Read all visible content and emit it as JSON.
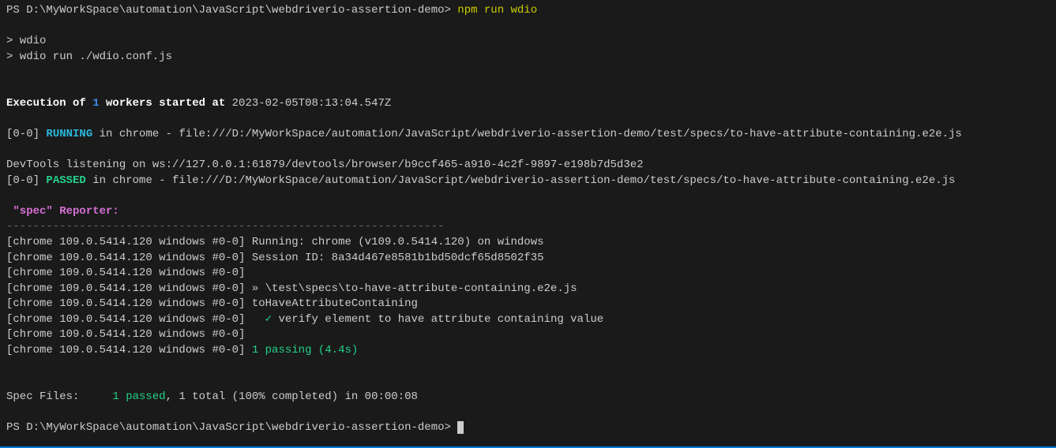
{
  "prompt1_path": "PS D:\\MyWorkSpace\\automation\\JavaScript\\webdriverio-assertion-demo> ",
  "prompt1_cmd": "npm run wdio",
  "script_lines": [
    "> wdio",
    "> wdio run ./wdio.conf.js"
  ],
  "exec_prefix": "Execution of ",
  "exec_workers": "1",
  "exec_mid": " workers started at ",
  "exec_ts": "2023-02-05T08:13:04.547Z",
  "running_prefix": "[0-0] ",
  "running_status": "RUNNING",
  "running_rest": " in chrome - file:///D:/MyWorkSpace/automation/JavaScript/webdriverio-assertion-demo/test/specs/to-have-attribute-containing.e2e.js",
  "devtools": "DevTools listening on ws://127.0.0.1:61879/devtools/browser/b9ccf465-a910-4c2f-9897-e198b7d5d3e2",
  "passed_prefix": "[0-0] ",
  "passed_status": "PASSED",
  "passed_rest": " in chrome - file:///D:/MyWorkSpace/automation/JavaScript/webdriverio-assertion-demo/test/specs/to-have-attribute-containing.e2e.js",
  "reporter_header": " \"spec\" Reporter:",
  "dashes": "------------------------------------------------------------------",
  "spec_prefix": "[chrome 109.0.5414.120 windows #0-0]",
  "spec_line1": " Running: chrome (v109.0.5414.120) on windows",
  "spec_line2": " Session ID: 8a34d467e8581b1bd50dcf65d8502f35",
  "spec_line3": "",
  "spec_line4": " » \\test\\specs\\to-have-attribute-containing.e2e.js",
  "spec_line5": " toHaveAttributeContaining",
  "spec_check": "   ✓ ",
  "spec_checktext": "verify element to have attribute containing value",
  "spec_line7": "",
  "spec_passing": " 1 passing (4.4s)",
  "summary_label": "Spec Files:     ",
  "summary_passed": "1 passed",
  "summary_rest": ", 1 total (100% completed) in 00:00:08",
  "prompt2_path": "PS D:\\MyWorkSpace\\automation\\JavaScript\\webdriverio-assertion-demo> "
}
